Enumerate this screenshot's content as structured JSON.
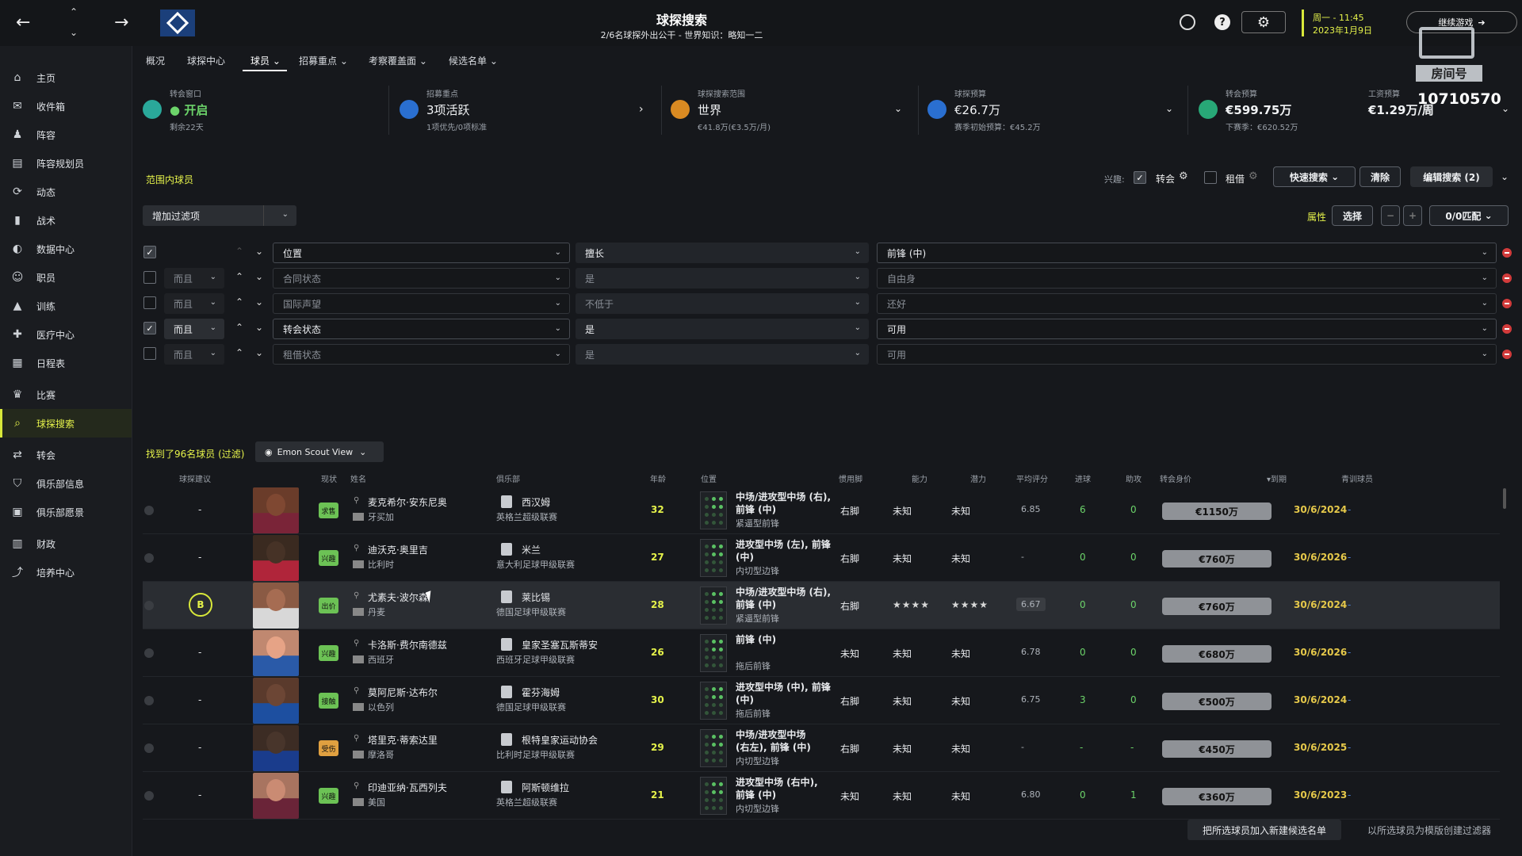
{
  "header": {
    "title": "球探搜索",
    "subtitle": "2/6名球探外出公干 - 世界知识：略知一二",
    "datetime_line1": "周一 - 11:45",
    "datetime_line2": "2023年1月9日",
    "continue_label": "继续游戏",
    "watermark_line1": "房间号",
    "watermark_number": "10710570"
  },
  "sidebar": {
    "items": [
      {
        "label": "主页",
        "icon": "home-icon"
      },
      {
        "label": "收件箱",
        "icon": "inbox-icon"
      },
      {
        "label": "阵容",
        "icon": "squad-icon"
      },
      {
        "label": "阵容规划员",
        "icon": "planner-icon"
      },
      {
        "label": "动态",
        "icon": "dynamics-icon"
      },
      {
        "label": "战术",
        "icon": "tactics-icon"
      },
      {
        "label": "数据中心",
        "icon": "data-icon"
      },
      {
        "label": "职员",
        "icon": "staff-icon"
      },
      {
        "label": "训练",
        "icon": "training-icon"
      },
      {
        "label": "医疗中心",
        "icon": "medical-icon"
      },
      {
        "label": "日程表",
        "icon": "calendar-icon"
      },
      {
        "label": "比赛",
        "icon": "trophy-icon"
      },
      {
        "label": "球探搜索",
        "icon": "search-icon"
      },
      {
        "label": "转会",
        "icon": "transfer-icon"
      },
      {
        "label": "俱乐部信息",
        "icon": "club-info-icon"
      },
      {
        "label": "俱乐部愿景",
        "icon": "club-vision-icon"
      },
      {
        "label": "财政",
        "icon": "finance-icon"
      },
      {
        "label": "培养中心",
        "icon": "development-icon"
      }
    ]
  },
  "tabs": [
    {
      "label": "概况"
    },
    {
      "label": "球探中心"
    },
    {
      "label": "球员"
    },
    {
      "label": "招募重点"
    },
    {
      "label": "考察覆盖面"
    },
    {
      "label": "候选名单"
    }
  ],
  "stats": {
    "window": {
      "label": "转会窗口",
      "value": "开启",
      "sub": "剩余22天"
    },
    "focus": {
      "label": "招募重点",
      "value": "3项活跃",
      "sub": "1项优先/0项标准"
    },
    "range": {
      "label": "球探搜索范围",
      "value": "世界",
      "sub": "€41.8万(€3.5万/月)"
    },
    "budget": {
      "label": "球探预算",
      "value": "€26.7万",
      "sub": "赛季初始预算：€45.2万"
    },
    "transfer": {
      "label": "转会预算",
      "value": "€599.75万",
      "sub": "下赛季：€620.52万"
    },
    "wage": {
      "label": "工资预算",
      "value": "€1.29万/周"
    }
  },
  "filters": {
    "section_title": "范围内球员",
    "interest_label": "兴趣:",
    "transfer_label": "转会",
    "loan_label": "租借",
    "quick_search": "快速搜索",
    "clear": "清除",
    "edit_search": "编辑搜索 (2)",
    "add_filter": "增加过滤项",
    "attr_label": "属性",
    "select_label": "选择",
    "match_label": "0/0匹配",
    "rows": [
      {
        "join": "",
        "field": "位置",
        "op": "擅长",
        "value": "前锋 (中)",
        "checked": true,
        "active": true
      },
      {
        "join": "而且",
        "field": "合同状态",
        "op": "是",
        "value": "自由身",
        "checked": false,
        "active": false
      },
      {
        "join": "而且",
        "field": "国际声望",
        "op": "不低于",
        "value": "还好",
        "checked": false,
        "active": false
      },
      {
        "join": "而且",
        "field": "转会状态",
        "op": "是",
        "value": "可用",
        "checked": true,
        "active": true
      },
      {
        "join": "而且",
        "field": "租借状态",
        "op": "是",
        "value": "可用",
        "checked": false,
        "active": false
      }
    ]
  },
  "results": {
    "count_label": "找到了96名球员 (过滤)",
    "view_label": "Emon Scout View",
    "headers": [
      "球探建议",
      "现状",
      "姓名",
      "俱乐部",
      "年龄",
      "位置",
      "惯用脚",
      "能力",
      "潜力",
      "平均评分",
      "进球",
      "助攻",
      "转会身价",
      "▾到期",
      "青训球员"
    ],
    "rows": [
      {
        "advice": "-",
        "status": "求售",
        "status_color": "#6cc255",
        "name": "麦克希尔·安东尼奥",
        "nation": "牙买加",
        "club": "西汉姆",
        "league": "英格兰超级联赛",
        "age": "32",
        "pos1": "中场/进攻型中场 (右),",
        "pos2": "前锋 (中)",
        "role": "紧逼型前锋",
        "foot": "右脚",
        "ability": "未知",
        "potential": "未知",
        "rating": "6.85",
        "goals": "6",
        "assists": "0",
        "value": "€1150万",
        "expiry": "30/6/2024",
        "youth": "-"
      },
      {
        "advice": "-",
        "status": "兴趣",
        "status_color": "#6cc255",
        "name": "迪沃克·奥里吉",
        "nation": "比利时",
        "club": "米兰",
        "league": "意大利足球甲级联赛",
        "age": "27",
        "pos1": "进攻型中场 (左), 前锋",
        "pos2": "(中)",
        "role": "内切型边锋",
        "foot": "右脚",
        "ability": "未知",
        "potential": "未知",
        "rating": "-",
        "goals": "0",
        "assists": "0",
        "value": "€760万",
        "expiry": "30/6/2026",
        "youth": "-"
      },
      {
        "advice": "B",
        "status": "出价",
        "status_color": "#6cc255",
        "name": "尤素夫·波尔森",
        "nation": "丹麦",
        "club": "莱比锡",
        "league": "德国足球甲级联赛",
        "age": "28",
        "pos1": "中场/进攻型中场 (右),",
        "pos2": "前锋 (中)",
        "role": "紧逼型前锋",
        "foot": "右脚",
        "ability": "★★★★",
        "potential": "★★★★",
        "rating": "6.67",
        "goals": "0",
        "assists": "0",
        "value": "€760万",
        "expiry": "30/6/2024",
        "youth": "-"
      },
      {
        "advice": "-",
        "status": "兴趣",
        "status_color": "#6cc255",
        "name": "卡洛斯·费尔南德兹",
        "nation": "西班牙",
        "club": "皇家圣塞瓦斯蒂安",
        "league": "西班牙足球甲级联赛",
        "age": "26",
        "pos1": "前锋 (中)",
        "pos2": "",
        "role": "拖后前锋",
        "foot": "未知",
        "ability": "未知",
        "potential": "未知",
        "rating": "6.78",
        "goals": "0",
        "assists": "0",
        "value": "€680万",
        "expiry": "30/6/2026",
        "youth": "-"
      },
      {
        "advice": "-",
        "status": "接触",
        "status_color": "#6cc255",
        "name": "莫阿尼斯·达布尔",
        "nation": "以色列",
        "club": "霍芬海姆",
        "league": "德国足球甲级联赛",
        "age": "30",
        "pos1": "进攻型中场 (中), 前锋",
        "pos2": "(中)",
        "role": "拖后前锋",
        "foot": "右脚",
        "ability": "未知",
        "potential": "未知",
        "rating": "6.75",
        "goals": "3",
        "assists": "0",
        "value": "€500万",
        "expiry": "30/6/2024",
        "youth": "-"
      },
      {
        "advice": "-",
        "status": "受伤",
        "status_color": "#e0a040",
        "name": "塔里克·蒂索达里",
        "nation": "摩洛哥",
        "club": "根特皇家运动协会",
        "league": "比利时足球甲级联赛",
        "age": "29",
        "pos1": "中场/进攻型中场",
        "pos2": "(右左), 前锋 (中)",
        "role": "内切型边锋",
        "foot": "右脚",
        "ability": "未知",
        "potential": "未知",
        "rating": "-",
        "goals": "-",
        "assists": "-",
        "value": "€450万",
        "expiry": "30/6/2025",
        "youth": "-"
      },
      {
        "advice": "-",
        "status": "兴趣",
        "status_color": "#6cc255",
        "name": "印迪亚纳·瓦西列夫",
        "nation": "美国",
        "club": "阿斯顿维拉",
        "league": "英格兰超级联赛",
        "age": "21",
        "pos1": "进攻型中场 (右中),",
        "pos2": "前锋 (中)",
        "role": "内切型边锋",
        "foot": "未知",
        "ability": "未知",
        "potential": "未知",
        "rating": "6.80",
        "goals": "0",
        "assists": "1",
        "value": "€360万",
        "expiry": "30/6/2023",
        "youth": "-"
      }
    ]
  },
  "footer": {
    "add_shortlist": "把所选球员加入新建候选名单",
    "create_filter": "以所选球员为模版创建过滤器"
  },
  "colors": {
    "accent": "#d8e83a",
    "bg": "#16181c"
  }
}
